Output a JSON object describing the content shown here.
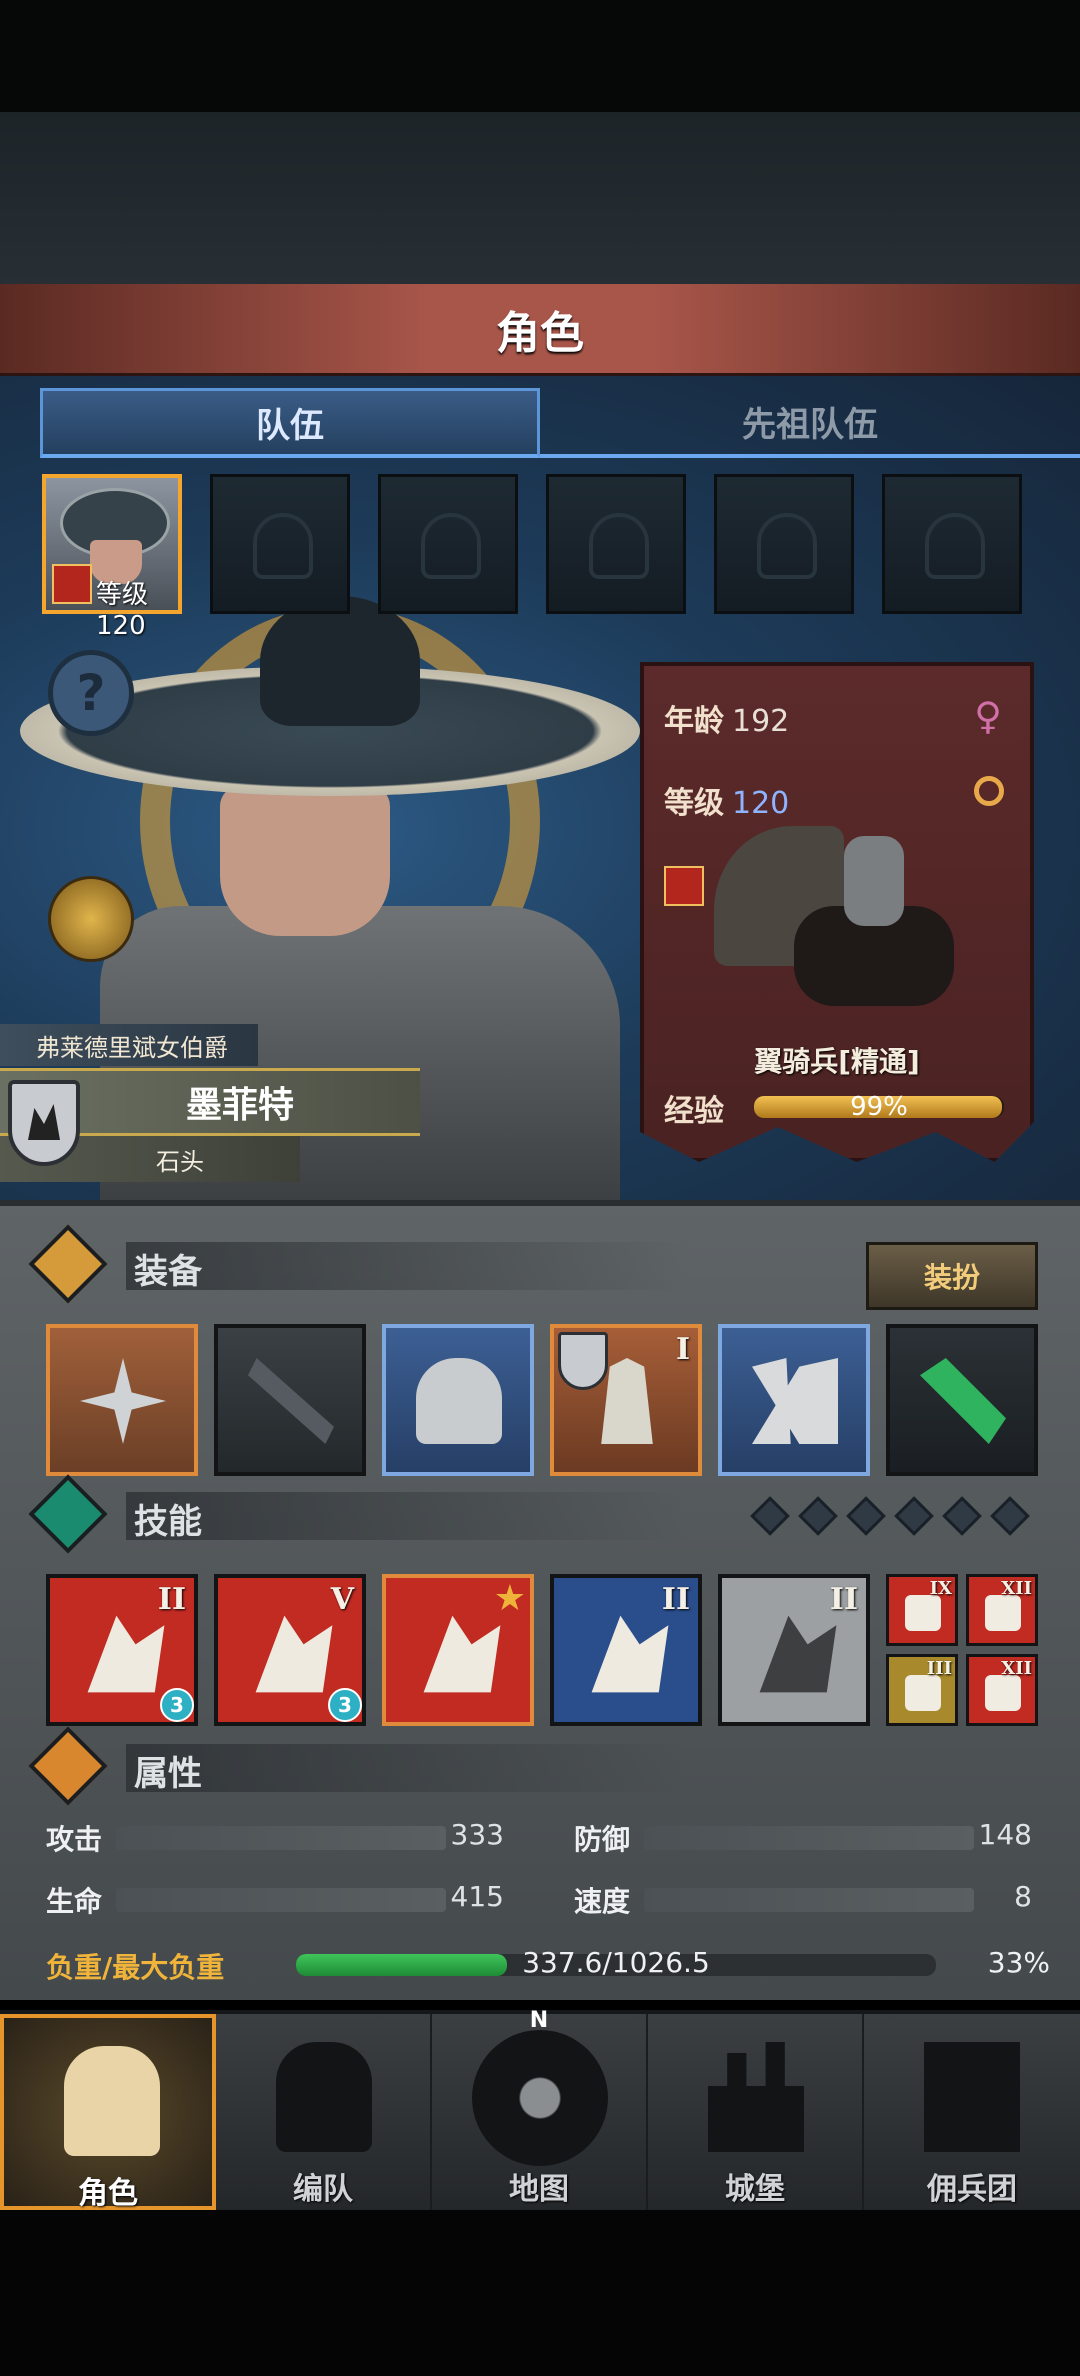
{
  "header": {
    "title": "角色"
  },
  "tabs": [
    {
      "label": "队伍",
      "active": true
    },
    {
      "label": "先祖队伍",
      "active": false
    }
  ],
  "party_slots": [
    {
      "filled": true,
      "level_text": "等级120"
    },
    {
      "filled": false
    },
    {
      "filled": false
    },
    {
      "filled": false
    },
    {
      "filled": false
    },
    {
      "filled": false
    }
  ],
  "character": {
    "title": "弗莱德里斌女伯爵",
    "name": "墨菲特",
    "subtitle": "石头"
  },
  "info_banner": {
    "age_label": "年龄",
    "age_value": "192",
    "level_label": "等级",
    "level_value": "120",
    "unit_name": "翼骑兵[精通]",
    "exp_label": "经验",
    "exp_percent_text": "99%",
    "exp_fraction": 0.99
  },
  "equipment": {
    "section_label": "装备",
    "outfit_button": "装扮",
    "items": [
      {
        "icon": "crossed-blades-icon",
        "roman": ""
      },
      {
        "icon": "polearm-icon",
        "roman": ""
      },
      {
        "icon": "great-helm-icon",
        "roman": ""
      },
      {
        "icon": "feather-armor-icon",
        "roman": "I"
      },
      {
        "icon": "greaves-icon",
        "roman": ""
      },
      {
        "icon": "emerald-charm-icon",
        "roman": ""
      }
    ]
  },
  "skills": {
    "section_label": "技能",
    "gem_count": 6,
    "active": [
      {
        "icon": "slash-skill-icon",
        "roman": "II",
        "badge": "3"
      },
      {
        "icon": "summon-skill-icon",
        "roman": "V",
        "badge": "3"
      },
      {
        "icon": "banner-skill-icon",
        "roman": "",
        "star": "★"
      },
      {
        "icon": "crystal-sword-skill-icon",
        "roman": "II"
      },
      {
        "icon": "crystal-shield-skill-icon",
        "roman": "II"
      }
    ],
    "passive": [
      {
        "icon": "heartbeat-icon",
        "roman": "IX"
      },
      {
        "icon": "dumbbell-icon",
        "roman": "XII"
      },
      {
        "icon": "shield-icon",
        "roman": "III"
      },
      {
        "icon": "sword-icon",
        "roman": "XII"
      }
    ]
  },
  "attributes": {
    "section_label": "属性",
    "attack_label": "攻击",
    "attack_value": "333",
    "defense_label": "防御",
    "defense_value": "148",
    "hp_label": "生命",
    "hp_value": "415",
    "speed_label": "速度",
    "speed_value": "8",
    "load_label": "负重/最大负重",
    "load_text": "337.6/1026.5",
    "load_percent_text": "33%",
    "load_fraction": 0.33
  },
  "nav": {
    "items": [
      {
        "label": "角色",
        "active": true
      },
      {
        "label": "编队"
      },
      {
        "label": "地图",
        "letter": "N"
      },
      {
        "label": "城堡"
      },
      {
        "label": "佣兵团"
      }
    ]
  },
  "colors": {
    "accent_orange": "#e5952a",
    "tab_blue": "#5c95d8",
    "exp_gold": "#f2c052",
    "load_green": "#3fc55a"
  }
}
